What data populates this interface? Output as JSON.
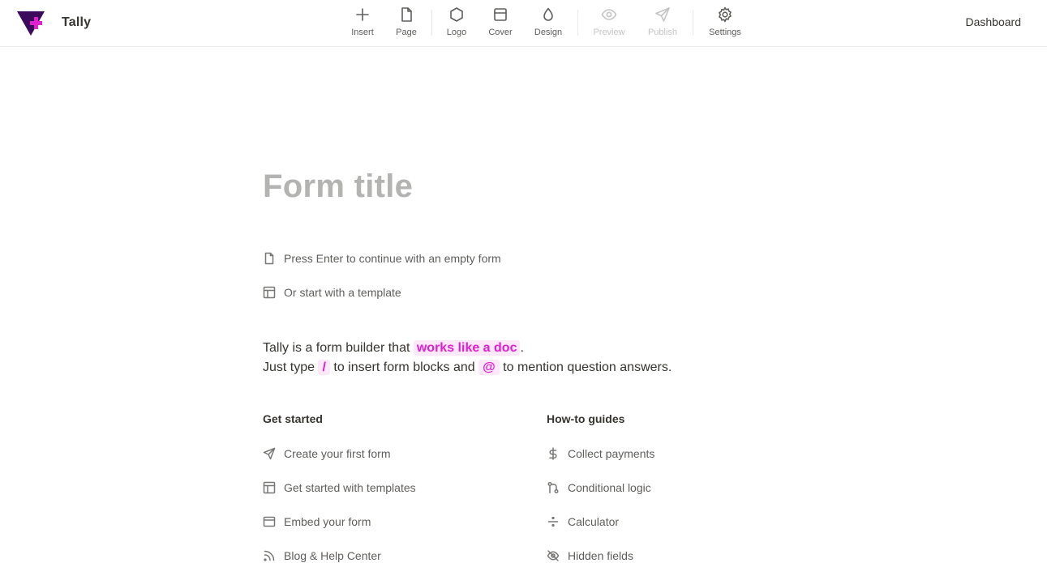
{
  "brand": {
    "name": "Tally"
  },
  "toolbar": {
    "items": [
      {
        "label": "Insert",
        "icon": "plus-icon"
      },
      {
        "label": "Page",
        "icon": "page-icon"
      },
      {
        "label": "Logo",
        "icon": "hexagon-icon"
      },
      {
        "label": "Cover",
        "icon": "cover-icon"
      },
      {
        "label": "Design",
        "icon": "droplet-icon"
      },
      {
        "label": "Preview",
        "icon": "eye-icon"
      },
      {
        "label": "Publish",
        "icon": "send-icon"
      },
      {
        "label": "Settings",
        "icon": "gear-icon"
      }
    ],
    "dashboard": "Dashboard"
  },
  "form": {
    "title_placeholder": "Form title"
  },
  "hints": {
    "empty": "Press Enter to continue with an empty form",
    "template": "Or start with a template"
  },
  "intro": {
    "line1_pre": "Tally is a form builder that ",
    "line1_highlight": "works like a doc",
    "line1_post": ".",
    "line2_pre": "Just type ",
    "line2_slash": "/",
    "line2_mid": " to insert form blocks and ",
    "line2_at": "@",
    "line2_post": " to mention question answers."
  },
  "get_started": {
    "title": "Get started",
    "items": [
      {
        "label": "Create your first form",
        "icon": "send-icon"
      },
      {
        "label": "Get started with templates",
        "icon": "template-icon"
      },
      {
        "label": "Embed your form",
        "icon": "embed-icon"
      },
      {
        "label": "Blog & Help Center",
        "icon": "rss-icon"
      }
    ]
  },
  "guides": {
    "title": "How-to guides",
    "items": [
      {
        "label": "Collect payments",
        "icon": "dollar-icon"
      },
      {
        "label": "Conditional logic",
        "icon": "logic-icon"
      },
      {
        "label": "Calculator",
        "icon": "divide-icon"
      },
      {
        "label": "Hidden fields",
        "icon": "eye-off-icon"
      }
    ]
  },
  "colors": {
    "accent": "#e01fcf",
    "accent_bg": "#fbe8f9",
    "logo_dark": "#3b0a5c",
    "logo_plus": "#e01fcf"
  }
}
